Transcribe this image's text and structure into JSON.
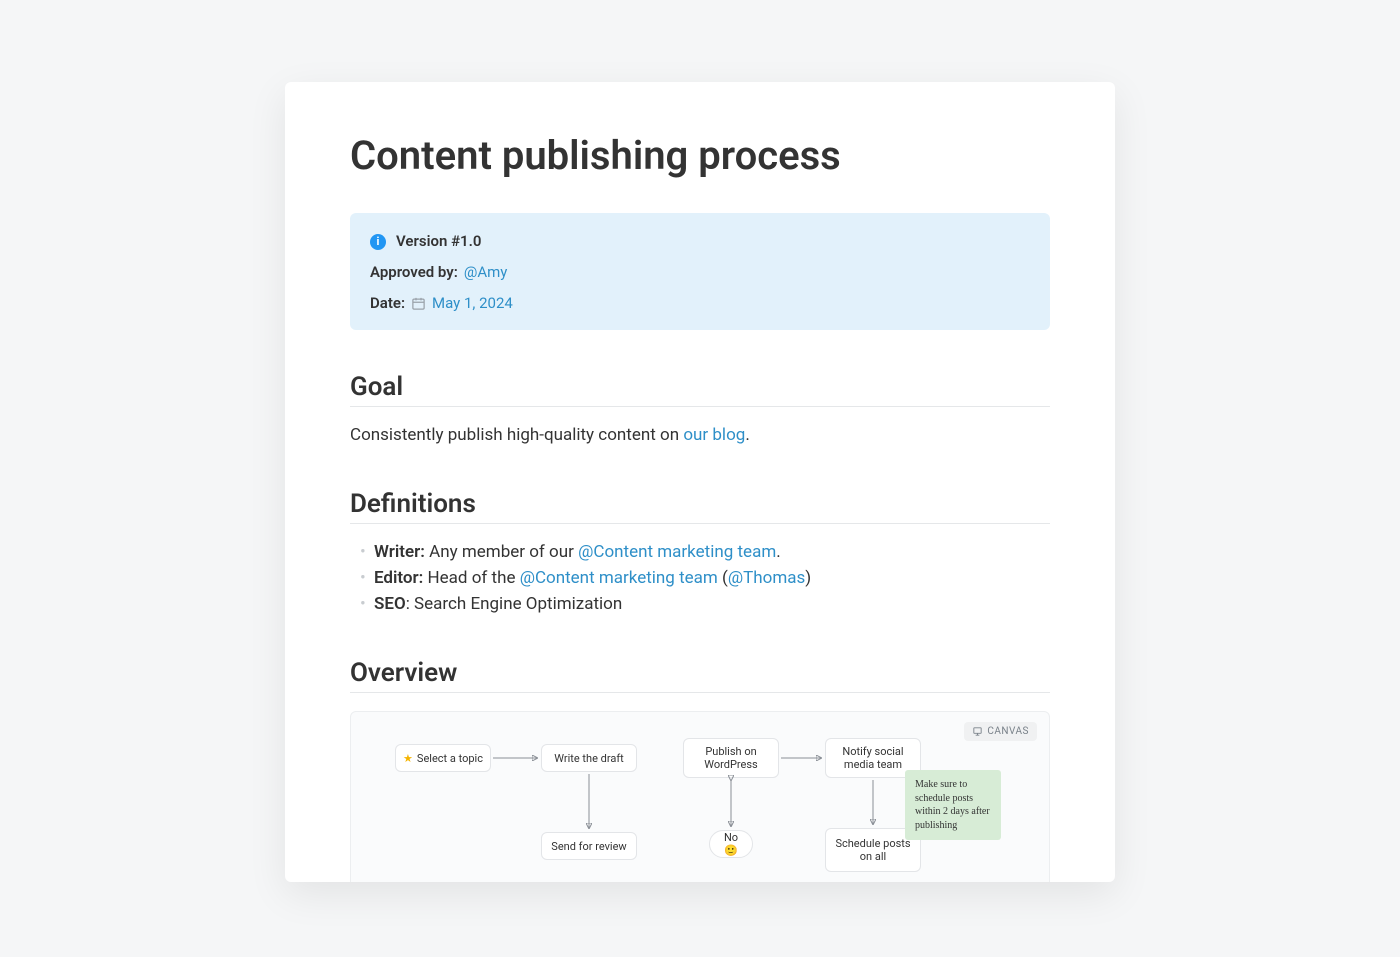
{
  "title": "Content publishing process",
  "banner": {
    "version_label": "Version #1.0",
    "approved_label": "Approved by:",
    "approved_by": "@Amy",
    "date_label": "Date:",
    "date_value": "May 1, 2024"
  },
  "goal": {
    "heading": "Goal",
    "text_before": "Consistently publish high-quality content on ",
    "link_text": "our blog",
    "text_after": "."
  },
  "definitions": {
    "heading": "Definitions",
    "items": [
      {
        "term": "Writer:",
        "prefix": " Any member of our ",
        "link1": "@Content marketing team",
        "suffix": "."
      },
      {
        "term": "Editor:",
        "prefix": " Head of the ",
        "link1": "@Content marketing team",
        "mid": " (",
        "link2": "@Thomas",
        "suffix": ")"
      },
      {
        "term": "SEO",
        "suffix": ": Search Engine Optimization"
      }
    ]
  },
  "overview": {
    "heading": "Overview",
    "canvas_badge": "CANVAS",
    "nodes": {
      "select_topic": "Select a topic",
      "write_draft": "Write the draft",
      "send_review": "Send for review",
      "publish_wp": "Publish on WordPress",
      "no_emoji": "No 🙂",
      "notify_social": "Notify social media team",
      "schedule_posts": "Schedule posts on all"
    },
    "sticky_note": "Make sure to schedule posts within 2 days after publishing"
  }
}
